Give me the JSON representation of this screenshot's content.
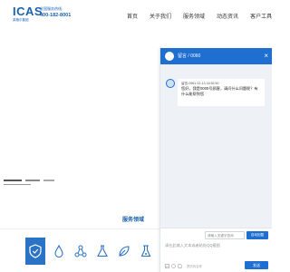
{
  "header": {
    "logo": "ICAS",
    "logo_sub": "英格尔集团",
    "hotline_label": "全国服务热线:",
    "hotline_number": "400-182-8001",
    "nav": [
      {
        "label": "首页"
      },
      {
        "label": "关于我们"
      },
      {
        "label": "服务领域"
      },
      {
        "label": "动态资讯"
      },
      {
        "label": "客户工具"
      }
    ]
  },
  "section": {
    "title": "服务领域"
  },
  "chat": {
    "title": "留言 / 0060",
    "close_glyph": "×",
    "message": {
      "meta": "留言-0961 02-13 16:52:50",
      "text": "您好，我是0000号顾客，请问什么问题呢？有什么能帮到您"
    },
    "query_placeholder": "请输入关键字查询",
    "query_button": "自动回复",
    "compose_placeholder": "请在此输入文本或者粘贴QQ截图",
    "powered_by": "提供商名称",
    "send_label": "发送",
    "accent_color": "#1e6fd0"
  }
}
